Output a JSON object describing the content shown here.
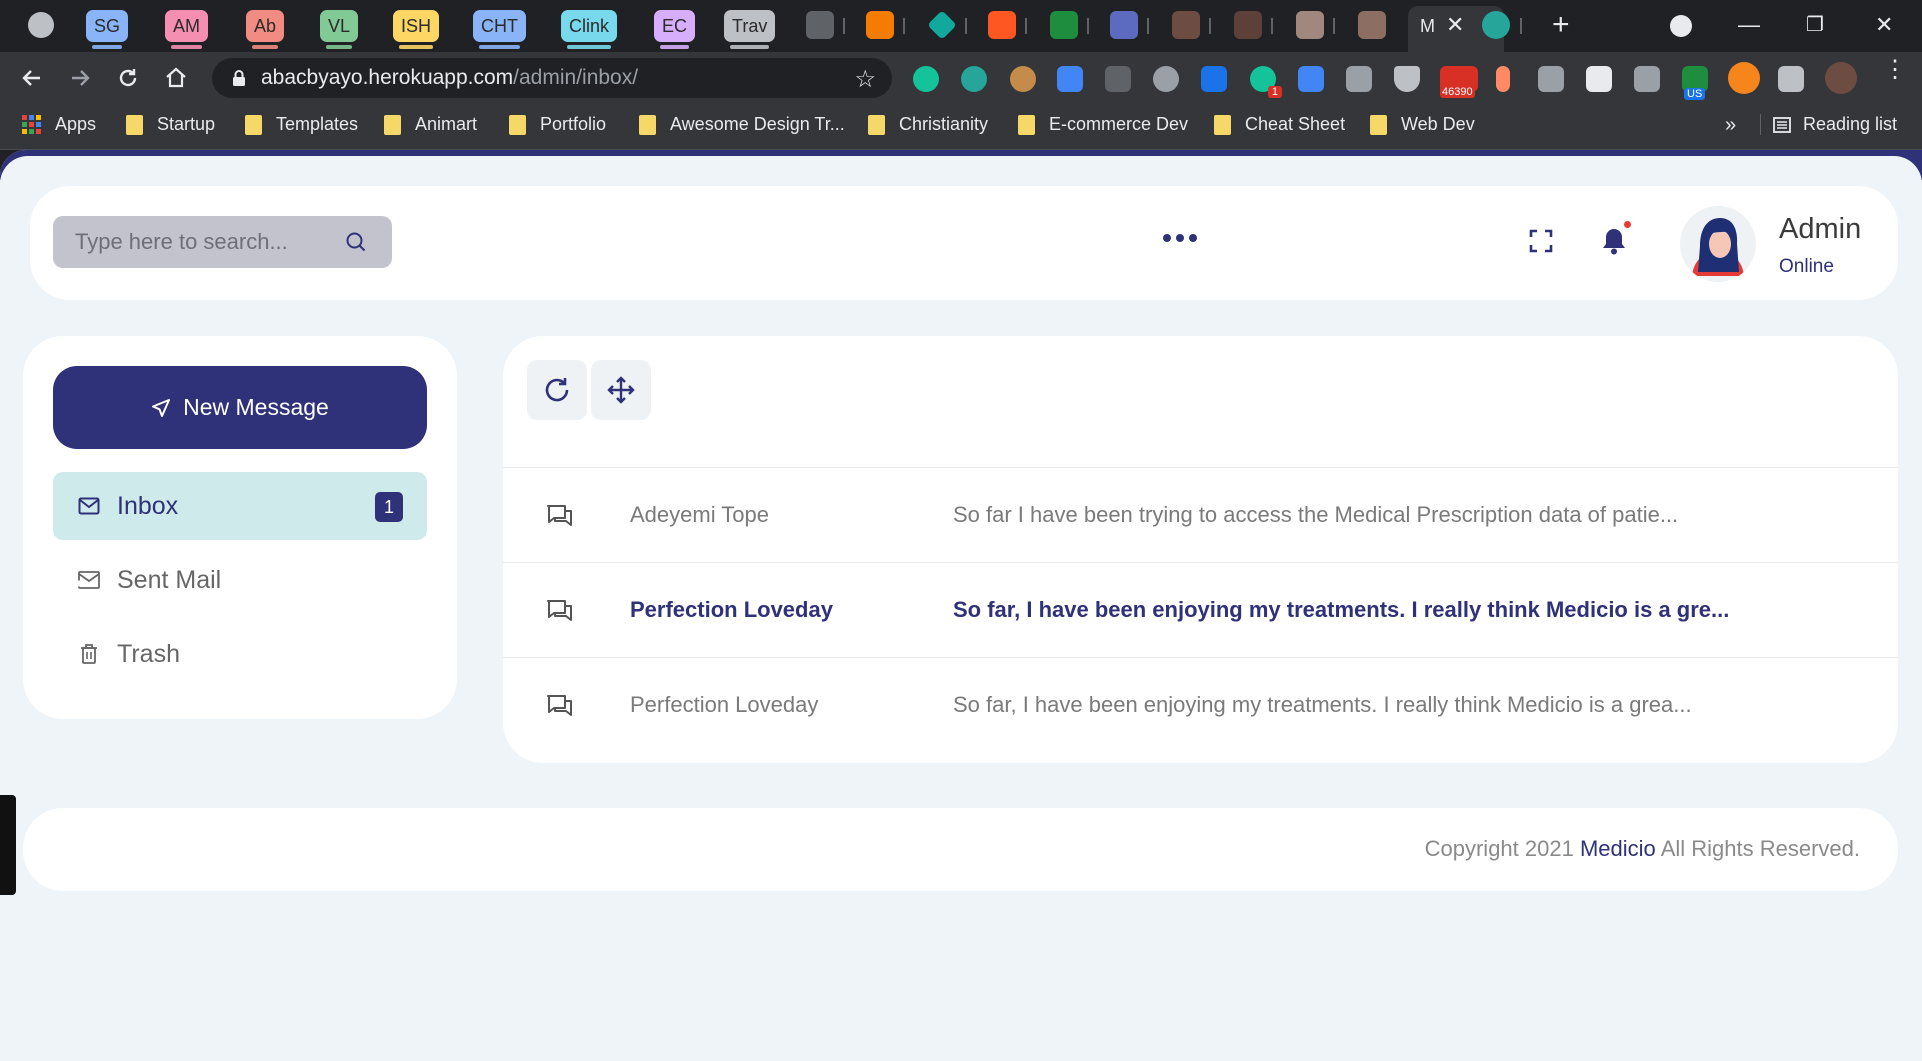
{
  "browser": {
    "tabs": [
      {
        "label": "SG",
        "color": "#8ab4f8"
      },
      {
        "label": "AM",
        "color": "#f48fb1"
      },
      {
        "label": "Ab",
        "color": "#f28b82"
      },
      {
        "label": "VL",
        "color": "#81c995"
      },
      {
        "label": "ISH",
        "color": "#fdd663"
      },
      {
        "label": "CHT",
        "color": "#8ab4f8"
      },
      {
        "label": "Clink",
        "color": "#78d9ec"
      },
      {
        "label": "EC",
        "color": "#d7aefb"
      },
      {
        "label": "Trav",
        "color": "#bdc1c6"
      }
    ],
    "active_tab_label": "M",
    "url_host": "abacbyayo.herokuapp.com",
    "url_path": "/admin/inbox/",
    "extension_badges": {
      "mail_count": "46390",
      "vpn": "US",
      "grammarly": "1"
    },
    "bookmarks": [
      "Apps",
      "Startup",
      "Templates",
      "Animart",
      "Portfolio",
      "Awesome Design Tr...",
      "Christianity",
      "E-commerce Dev",
      "Cheat Sheet",
      "Web Dev"
    ],
    "reading_list": "Reading list",
    "more": "»"
  },
  "header": {
    "search_placeholder": "Type here to search...",
    "admin_name": "Admin",
    "admin_status": "Online"
  },
  "sidebar": {
    "new_message": "New Message",
    "items": [
      {
        "label": "Inbox",
        "badge": "1"
      },
      {
        "label": "Sent Mail"
      },
      {
        "label": "Trash"
      }
    ]
  },
  "messages": [
    {
      "from": "Adeyemi Tope",
      "subject": "So far I have been trying to access the Medical Prescription data of patie...",
      "unread": false
    },
    {
      "from": "Perfection Loveday",
      "subject": "So far, I have been enjoying my treatments. I really think Medicio is a gre...",
      "unread": true
    },
    {
      "from": "Perfection Loveday",
      "subject": "So far, I have been enjoying my treatments. I really think Medicio is a grea...",
      "unread": false
    }
  ],
  "footer": {
    "copyright_prefix": "Copyright 2021",
    "brand": "Medicio",
    "suffix": "All Rights Reserved."
  },
  "colors": {
    "primary": "#2f3179",
    "accent_light": "#cfeaea",
    "background": "#eef4f7"
  }
}
